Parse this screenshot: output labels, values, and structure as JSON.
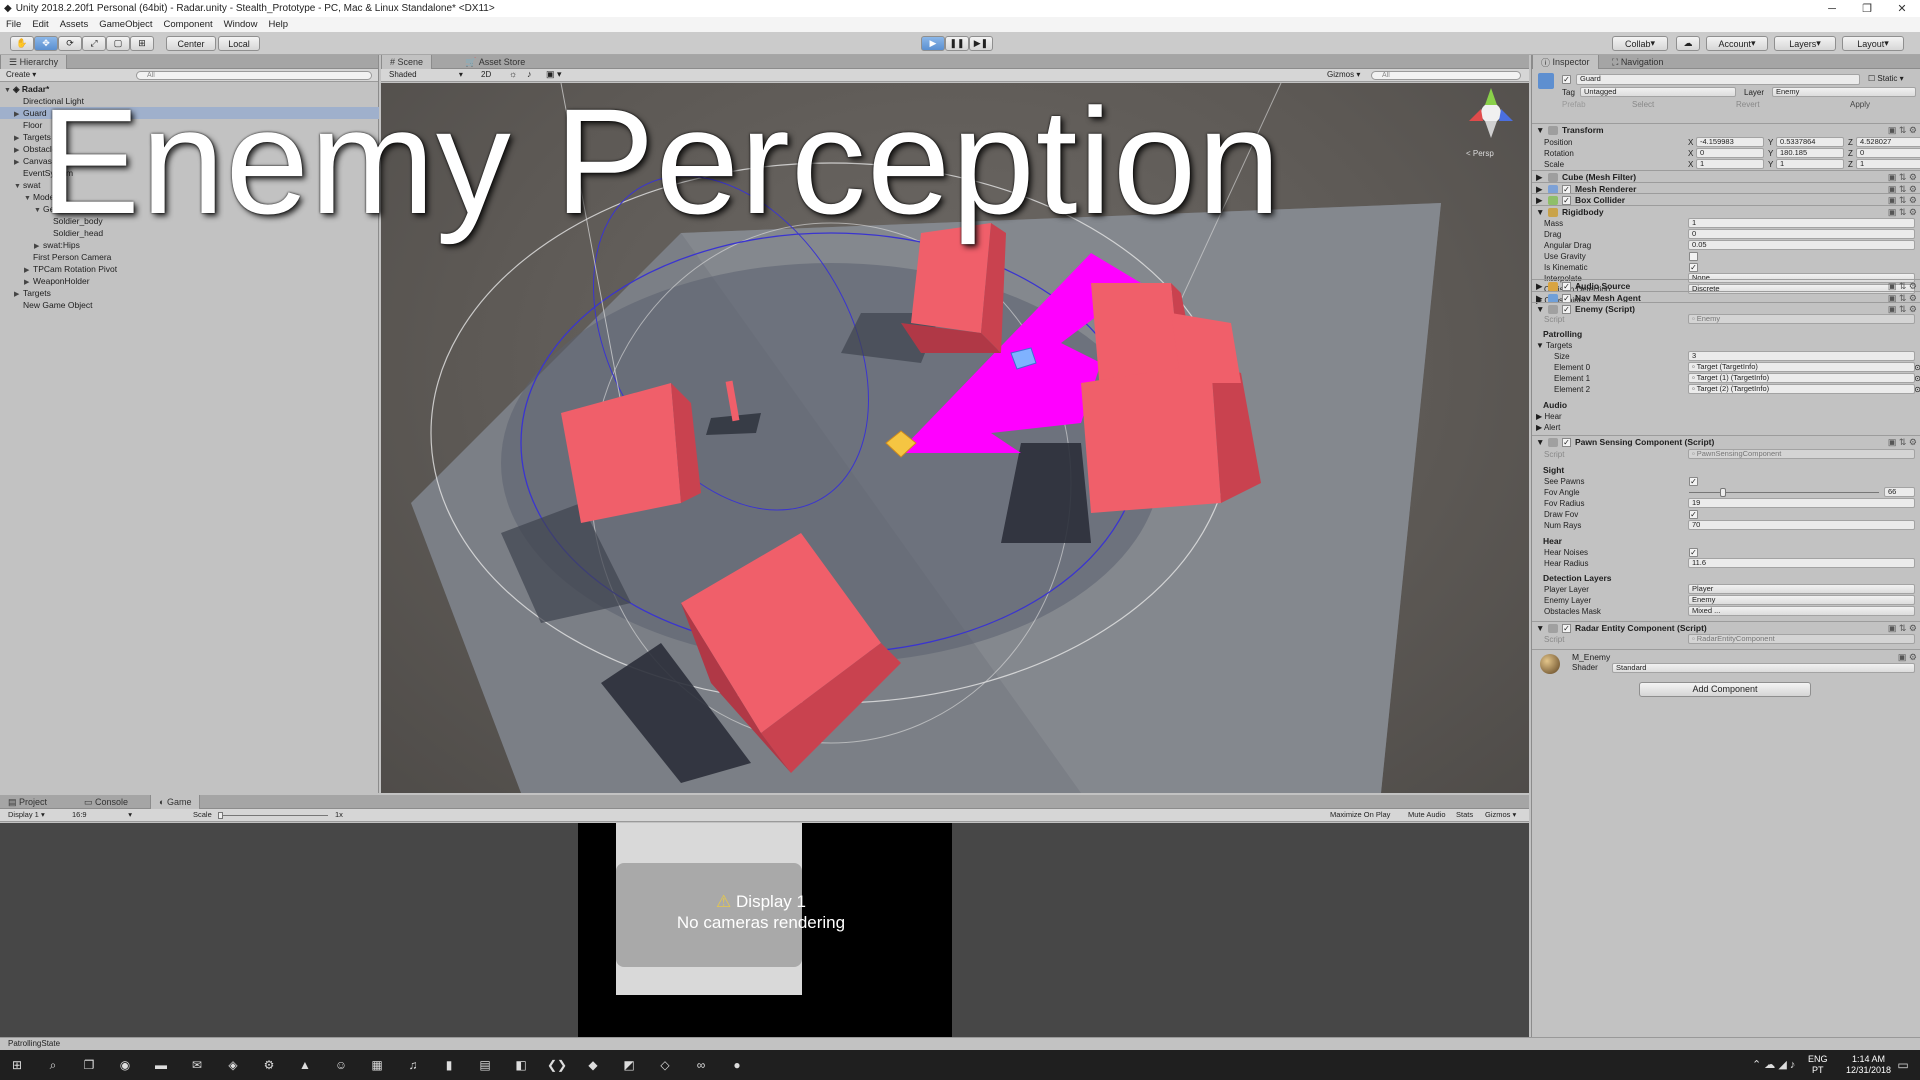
{
  "window": {
    "title": "Unity 2018.2.20f1 Personal (64bit) - Radar.unity - Stealth_Prototype - PC, Mac & Linux Standalone* <DX11>"
  },
  "menu": [
    "File",
    "Edit",
    "Assets",
    "GameObject",
    "Component",
    "Window",
    "Help"
  ],
  "toolbar": {
    "center_label": "Center",
    "local_label": "Local",
    "collab_label": "Collab",
    "account_label": "Account",
    "layers_label": "Layers",
    "layout_label": "Layout"
  },
  "hierarchy": {
    "tab": "Hierarchy",
    "create_label": "Create",
    "search_placeholder": "All",
    "scene_name": "Radar*",
    "items": [
      {
        "label": "Directional Light",
        "indent": 1,
        "arrow": ""
      },
      {
        "label": "Guard",
        "indent": 1,
        "arrow": "▶",
        "selected": true
      },
      {
        "label": "Floor",
        "indent": 1,
        "arrow": ""
      },
      {
        "label": "Targets",
        "indent": 1,
        "arrow": "▶"
      },
      {
        "label": "Obstacles",
        "indent": 1,
        "arrow": "▶"
      },
      {
        "label": "Canvas",
        "indent": 1,
        "arrow": "▶"
      },
      {
        "label": "EventSystem",
        "indent": 1,
        "arrow": ""
      },
      {
        "label": "swat",
        "indent": 1,
        "arrow": "▼"
      },
      {
        "label": "Model",
        "indent": 2,
        "arrow": "▼"
      },
      {
        "label": "Geo",
        "indent": 3,
        "arrow": "▼"
      },
      {
        "label": "Soldier_body",
        "indent": 4,
        "arrow": ""
      },
      {
        "label": "Soldier_head",
        "indent": 4,
        "arrow": ""
      },
      {
        "label": "swat:Hips",
        "indent": 3,
        "arrow": "▶"
      },
      {
        "label": "First Person Camera",
        "indent": 2,
        "arrow": ""
      },
      {
        "label": "TPCam Rotation Pivot",
        "indent": 2,
        "arrow": "▶"
      },
      {
        "label": "WeaponHolder",
        "indent": 2,
        "arrow": "▶"
      },
      {
        "label": "Targets",
        "indent": 1,
        "arrow": "▶"
      },
      {
        "label": "New Game Object",
        "indent": 1,
        "arrow": ""
      }
    ]
  },
  "scene": {
    "tabs": [
      "Scene",
      "Asset Store"
    ],
    "shading": "Shaded",
    "mode_2d": "2D",
    "gizmos_label": "Gizmos",
    "search_placeholder": "All",
    "persp_label": "< Persp",
    "overlay_title": "Enemy Perception"
  },
  "bottom": {
    "tabs": [
      "Project",
      "Console",
      "Game"
    ],
    "display": "Display 1",
    "aspect": "16:9",
    "scale_label": "Scale",
    "scale_value": "1x",
    "buttons": [
      "Maximize On Play",
      "Mute Audio",
      "Stats",
      "Gizmos"
    ],
    "message_line1": "Display 1",
    "message_line2": "No cameras rendering"
  },
  "status": "PatrollingState",
  "inspector": {
    "tabs": [
      "Inspector",
      "Navigation"
    ],
    "object_name": "Guard",
    "static_label": "Static",
    "tag_label": "Tag",
    "tag_value": "Untagged",
    "layer_label": "Layer",
    "layer_value": "Enemy",
    "prefab_label": "Prefab",
    "prefab_buttons": [
      "Select",
      "Revert",
      "Apply"
    ],
    "transform": {
      "title": "Transform",
      "rows": [
        {
          "label": "Position",
          "x": "-4.159983",
          "y": "0.5337864",
          "z": "4.528027"
        },
        {
          "label": "Rotation",
          "x": "0",
          "y": "180.185",
          "z": "0"
        },
        {
          "label": "Scale",
          "x": "1",
          "y": "1",
          "z": "1"
        }
      ]
    },
    "components": [
      "Cube (Mesh Filter)",
      "Mesh Renderer",
      "Box Collider",
      "Rigidbody"
    ],
    "rigidbody": [
      {
        "label": "Mass",
        "value": "1"
      },
      {
        "label": "Drag",
        "value": "0"
      },
      {
        "label": "Angular Drag",
        "value": "0.05"
      },
      {
        "label": "Use Gravity",
        "check": false
      },
      {
        "label": "Is Kinematic",
        "check": true
      },
      {
        "label": "Interpolate",
        "value": "None",
        "dropdown": true
      },
      {
        "label": "Collision Detection",
        "value": "Discrete",
        "dropdown": true
      },
      {
        "label": "Constraints",
        "arrow": true
      }
    ],
    "components2": [
      "Audio Source",
      "Nav Mesh Agent",
      "Enemy (Script)"
    ],
    "enemy": {
      "script_label": "Script",
      "script_value": "Enemy",
      "patrolling": "Patrolling",
      "targets": "Targets",
      "size_label": "Size",
      "size_value": "3",
      "elements": [
        {
          "label": "Element 0",
          "value": "Target (TargetInfo)"
        },
        {
          "label": "Element 1",
          "value": "Target (1) (TargetInfo)"
        },
        {
          "label": "Element 2",
          "value": "Target (2) (TargetInfo)"
        }
      ],
      "audio": "Audio",
      "hear": "Hear",
      "alert": "Alert"
    },
    "pawn": {
      "title": "Pawn Sensing Component (Script)",
      "script_value": "PawnSensingComponent",
      "sight": "Sight",
      "see_pawns": "See Pawns",
      "fov_angle_label": "Fov Angle",
      "fov_angle_value": "66",
      "fov_angle_fraction": 0.18,
      "fov_radius_label": "Fov Radius",
      "fov_radius_value": "19",
      "draw_fov": "Draw Fov",
      "num_rays_label": "Num Rays",
      "num_rays_value": "70",
      "hear": "Hear",
      "hear_noises": "Hear Noises",
      "hear_radius_label": "Hear Radius",
      "hear_radius_value": "11.6",
      "detection": "Detection Layers",
      "player_layer_label": "Player Layer",
      "player_layer_value": "Player",
      "enemy_layer_label": "Enemy Layer",
      "enemy_layer_value": "Enemy",
      "obstacles_label": "Obstacles Mask",
      "obstacles_value": "Mixed ..."
    },
    "radar": {
      "title": "Radar Entity Component (Script)",
      "script_value": "RadarEntityComponent"
    },
    "material": {
      "name": "M_Enemy",
      "shader_label": "Shader",
      "shader_value": "Standard"
    },
    "add_component": "Add Component"
  },
  "taskbar": {
    "lang1": "ENG",
    "lang2": "PT",
    "time": "1:14 AM",
    "date": "12/31/2018"
  },
  "colors": {
    "obstacle": "#f05f6a",
    "fov": "#ff00ff",
    "accent": "#4d86d6"
  }
}
